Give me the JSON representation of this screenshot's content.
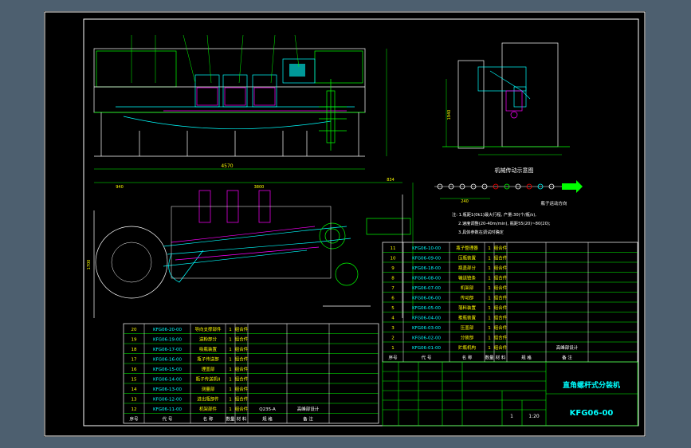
{
  "views": {
    "side_view_caption": "机械传动示意图",
    "direction_note": "瓶子运动方向"
  },
  "dimensions": {
    "main_overall_length": "4570",
    "side_overall_width": "1940",
    "plan_left": "940",
    "plan_top": "3800",
    "plan_height": "1700",
    "plan_right": "834",
    "pitch": "240"
  },
  "notes": {
    "line1": "注: 1.瓶距1(0k1)最大行程, 产量:30(个/瓶/s),",
    "line2": "2.速度调整(20-40m/min), 瓶距55(20)~80(20);",
    "line3": "3.具体参数在调试时确定"
  },
  "colors": {
    "background": "#000000",
    "frame": "#ffffff",
    "grid": "#00ff00",
    "text": "#ffff00",
    "machine": "#00ffff",
    "accent": "#ff00ff"
  },
  "upper_table": {
    "rows": [
      {
        "no": "11",
        "code": "KFG06-10-00",
        "name": "瓶子整理器",
        "qty": "1",
        "type": "组合件"
      },
      {
        "no": "10",
        "code": "KFG06-09-00",
        "name": "压瓶装置",
        "qty": "1",
        "type": "组合件"
      },
      {
        "no": "9",
        "code": "KFG06-18-00",
        "name": "瓶盖部分",
        "qty": "1",
        "type": "组合件"
      },
      {
        "no": "8",
        "code": "KFG06-08-00",
        "name": "输送链条",
        "qty": "1",
        "type": "组合件"
      },
      {
        "no": "7",
        "code": "KFG06-07-00",
        "name": "机架部",
        "qty": "1",
        "type": "组合件"
      },
      {
        "no": "6",
        "code": "KFG06-06-00",
        "name": "传动部",
        "qty": "1",
        "type": "组合件"
      },
      {
        "no": "5",
        "code": "KFG06-05-00",
        "name": "落料装置",
        "qty": "1",
        "type": "组合件"
      },
      {
        "no": "4",
        "code": "KFG06-04-00",
        "name": "推瓶装置",
        "qty": "1",
        "type": "组合件"
      },
      {
        "no": "3",
        "code": "KFG06-03-00",
        "name": "压盖部",
        "qty": "1",
        "type": "组合件"
      },
      {
        "no": "2",
        "code": "KFG06-02-00",
        "name": "分装部",
        "qty": "1",
        "type": "组合件"
      },
      {
        "no": "1",
        "code": "KFG06-01-00",
        "name": "贮瓶机构",
        "qty": "1",
        "type": "组合件"
      }
    ],
    "header": {
      "no": "序号",
      "code": "代 号",
      "name": "名 称",
      "qty": "数量",
      "material": "材 料",
      "spec": "规 格",
      "remark": "备 注"
    },
    "designer": "高峰部设计"
  },
  "lower_table": {
    "rows": [
      {
        "no": "20",
        "code": "KFG06-20-00",
        "name": "导向支撑部件",
        "qty": "1",
        "type": "组合件"
      },
      {
        "no": "19",
        "code": "KFG06-19-00",
        "name": "送粉部分",
        "qty": "1",
        "type": "组合件"
      },
      {
        "no": "18",
        "code": "KFG06-17-00",
        "name": "吸瓶装置",
        "qty": "1",
        "type": "组合件"
      },
      {
        "no": "17",
        "code": "KFG06-16-00",
        "name": "瓶子传送部",
        "qty": "1",
        "type": "组合件"
      },
      {
        "no": "16",
        "code": "KFG06-15-00",
        "name": "理盖部",
        "qty": "1",
        "type": "组合件"
      },
      {
        "no": "15",
        "code": "KFG06-14-00",
        "name": "瓶子传送机II",
        "qty": "1",
        "type": "组合件"
      },
      {
        "no": "14",
        "code": "KFG06-13-00",
        "name": "测量部",
        "qty": "1",
        "type": "组合件"
      },
      {
        "no": "13",
        "code": "KFG06-12-00",
        "name": "进出瓶部件",
        "qty": "1",
        "type": "组合件"
      },
      {
        "no": "12",
        "code": "KFG06-11-00",
        "name": "机架部件",
        "qty": "1",
        "type": "组合件"
      }
    ],
    "header": {
      "no": "序号",
      "code": "代 号",
      "name": "名 称",
      "qty": "数量",
      "material": "材 料",
      "spec": "规 格",
      "remark": "备 注"
    },
    "designer": "高峰部设计",
    "spec_note": "Q235-A"
  },
  "title_block": {
    "title": "直角螺杆式分装机",
    "drawing_no": "KFG06-00",
    "scale": "1:20",
    "sheet_count": "1"
  }
}
